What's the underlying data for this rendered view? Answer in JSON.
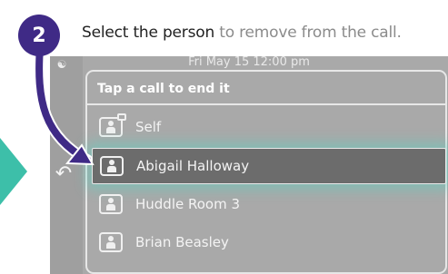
{
  "step": {
    "number": "2"
  },
  "instruction": {
    "main": "Select the person",
    "rest": " to remove from the call."
  },
  "device": {
    "date_time": "Fri May 15  12:00 pm",
    "panel_title": "Tap a call to end it",
    "rows": [
      {
        "label": "Self",
        "icon": "content-share-icon",
        "selected": false
      },
      {
        "label": "Abigail Halloway",
        "icon": "person-icon",
        "selected": true
      },
      {
        "label": "Huddle Room 3",
        "icon": "person-icon",
        "selected": false
      },
      {
        "label": "Brian Beasley",
        "icon": "person-icon",
        "selected": false
      }
    ]
  },
  "colors": {
    "badge": "#3f2a86",
    "arrow": "#3f2a86",
    "highlight_glow": "#53d6c4",
    "side_triangle": "#3dbfa9",
    "screen_bg": "#a9a9a9"
  }
}
